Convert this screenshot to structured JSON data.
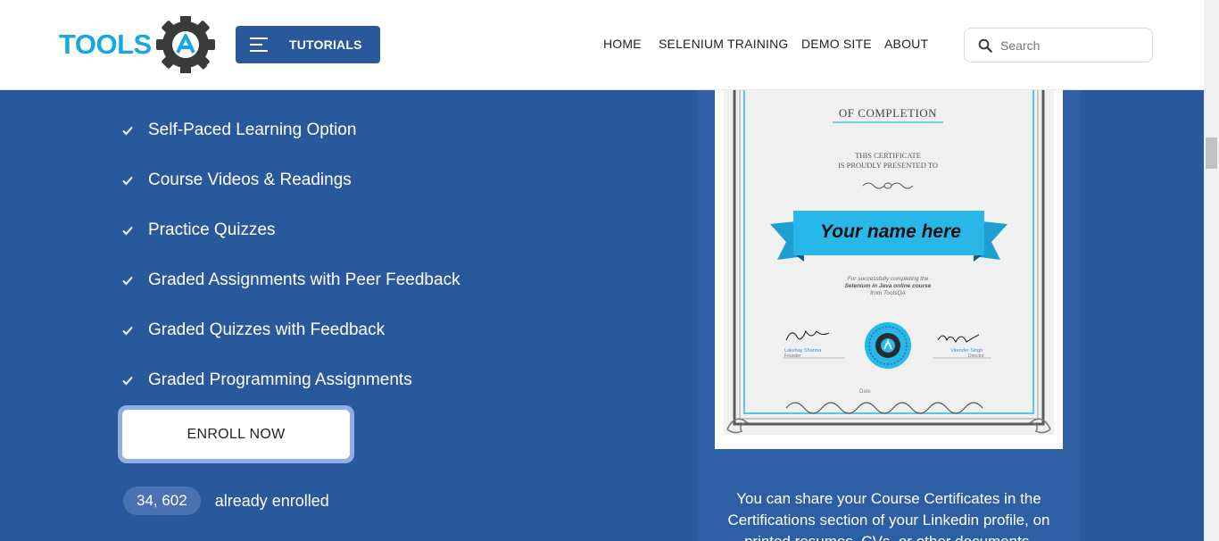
{
  "header": {
    "logo_text": "TOOLSQA",
    "tutorials_label": "TUTORIALS",
    "nav": [
      "HOME",
      "SELENIUM TRAINING",
      "DEMO SITE",
      "ABOUT"
    ],
    "search_placeholder": "Search"
  },
  "features": [
    "Self-Paced Learning Option",
    "Course Videos & Readings",
    "Practice Quizzes",
    "Graded Assignments with Peer Feedback",
    "Graded Quizzes with Feedback",
    "Graded Programming Assignments"
  ],
  "enroll": {
    "button_label": "ENROLL NOW",
    "count": "34, 602",
    "count_label": "already enrolled"
  },
  "certificate": {
    "heading": "OF COMPLETION",
    "presented_line1": "THIS CERTIFICATE",
    "presented_line2": "IS PROUDLY PRESENTED TO",
    "name_placeholder": "Your name here",
    "desc_line1": "For successfully completing the",
    "desc_line2": "Selenium in Java online course",
    "desc_line3": "from ToolsQA",
    "signer1_name": "Lakshay Sharma",
    "signer1_title": "Founder",
    "signer2_name": "Virender Singh",
    "signer2_title": "Director",
    "date_label": "Date"
  },
  "share_text": "You can share your Course Certificates in the Certifications section of your Linkedin profile, on printed resumes, CVs, or other documents.",
  "colors": {
    "brand_blue": "#29599c",
    "logo_cyan": "#1aa7e0",
    "ribbon": "#29b6e8"
  }
}
